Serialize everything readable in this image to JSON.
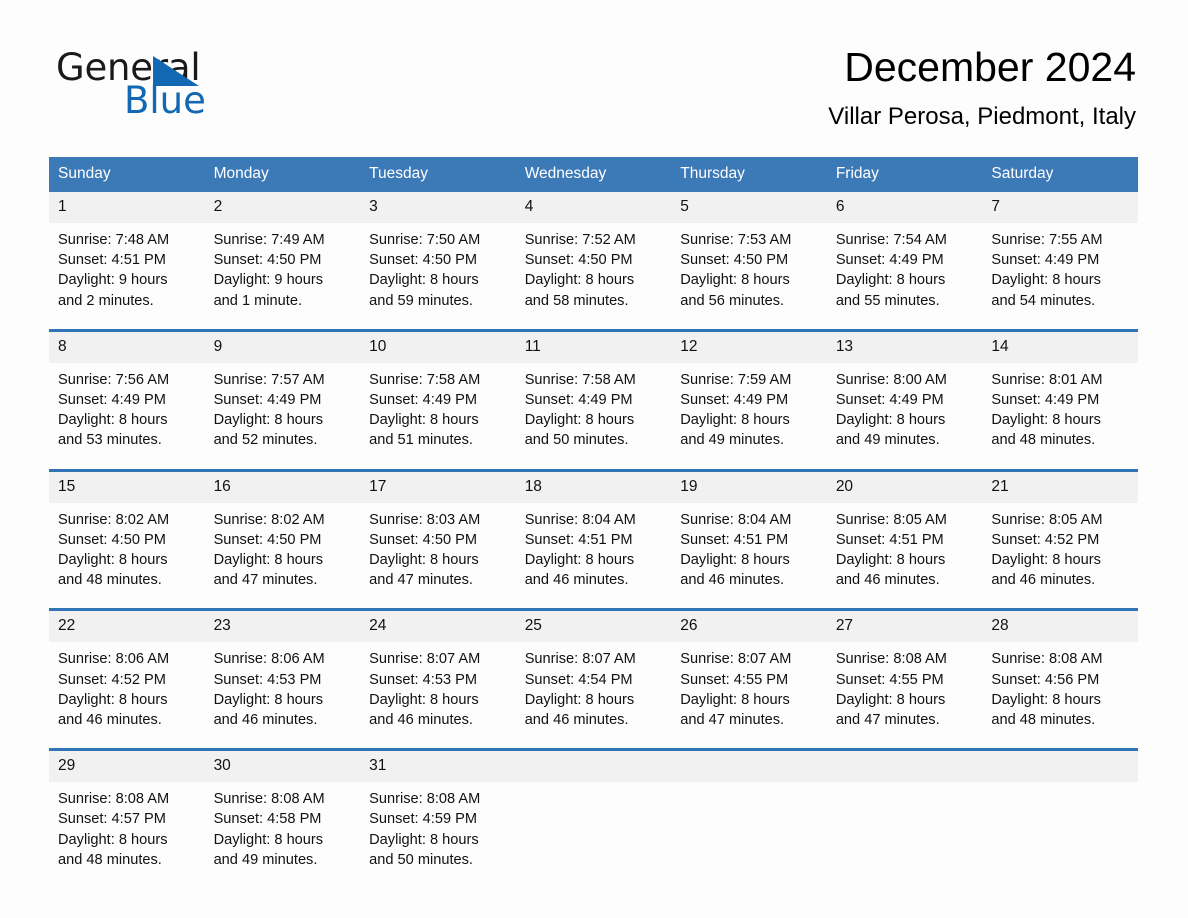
{
  "brand": {
    "name_part1": "General",
    "name_part2": "Blue",
    "accent_color": "#1268b3"
  },
  "header": {
    "title": "December 2024",
    "subtitle": "Villar Perosa, Piedmont, Italy"
  },
  "theme": {
    "header_blue": "#3b79b7",
    "separator_blue": "#2f74b5",
    "daynum_band": "#f1f1f1",
    "page_background": "#fdfdfd"
  },
  "columns": [
    "Sunday",
    "Monday",
    "Tuesday",
    "Wednesday",
    "Thursday",
    "Friday",
    "Saturday"
  ],
  "weeks": [
    {
      "days": [
        {
          "num": "1",
          "detail": "Sunrise: 7:48 AM\nSunset: 4:51 PM\nDaylight: 9 hours\nand 2 minutes."
        },
        {
          "num": "2",
          "detail": "Sunrise: 7:49 AM\nSunset: 4:50 PM\nDaylight: 9 hours\nand 1 minute."
        },
        {
          "num": "3",
          "detail": "Sunrise: 7:50 AM\nSunset: 4:50 PM\nDaylight: 8 hours\nand 59 minutes."
        },
        {
          "num": "4",
          "detail": "Sunrise: 7:52 AM\nSunset: 4:50 PM\nDaylight: 8 hours\nand 58 minutes."
        },
        {
          "num": "5",
          "detail": "Sunrise: 7:53 AM\nSunset: 4:50 PM\nDaylight: 8 hours\nand 56 minutes."
        },
        {
          "num": "6",
          "detail": "Sunrise: 7:54 AM\nSunset: 4:49 PM\nDaylight: 8 hours\nand 55 minutes."
        },
        {
          "num": "7",
          "detail": "Sunrise: 7:55 AM\nSunset: 4:49 PM\nDaylight: 8 hours\nand 54 minutes."
        }
      ]
    },
    {
      "days": [
        {
          "num": "8",
          "detail": "Sunrise: 7:56 AM\nSunset: 4:49 PM\nDaylight: 8 hours\nand 53 minutes."
        },
        {
          "num": "9",
          "detail": "Sunrise: 7:57 AM\nSunset: 4:49 PM\nDaylight: 8 hours\nand 52 minutes."
        },
        {
          "num": "10",
          "detail": "Sunrise: 7:58 AM\nSunset: 4:49 PM\nDaylight: 8 hours\nand 51 minutes."
        },
        {
          "num": "11",
          "detail": "Sunrise: 7:58 AM\nSunset: 4:49 PM\nDaylight: 8 hours\nand 50 minutes."
        },
        {
          "num": "12",
          "detail": "Sunrise: 7:59 AM\nSunset: 4:49 PM\nDaylight: 8 hours\nand 49 minutes."
        },
        {
          "num": "13",
          "detail": "Sunrise: 8:00 AM\nSunset: 4:49 PM\nDaylight: 8 hours\nand 49 minutes."
        },
        {
          "num": "14",
          "detail": "Sunrise: 8:01 AM\nSunset: 4:49 PM\nDaylight: 8 hours\nand 48 minutes."
        }
      ]
    },
    {
      "days": [
        {
          "num": "15",
          "detail": "Sunrise: 8:02 AM\nSunset: 4:50 PM\nDaylight: 8 hours\nand 48 minutes."
        },
        {
          "num": "16",
          "detail": "Sunrise: 8:02 AM\nSunset: 4:50 PM\nDaylight: 8 hours\nand 47 minutes."
        },
        {
          "num": "17",
          "detail": "Sunrise: 8:03 AM\nSunset: 4:50 PM\nDaylight: 8 hours\nand 47 minutes."
        },
        {
          "num": "18",
          "detail": "Sunrise: 8:04 AM\nSunset: 4:51 PM\nDaylight: 8 hours\nand 46 minutes."
        },
        {
          "num": "19",
          "detail": "Sunrise: 8:04 AM\nSunset: 4:51 PM\nDaylight: 8 hours\nand 46 minutes."
        },
        {
          "num": "20",
          "detail": "Sunrise: 8:05 AM\nSunset: 4:51 PM\nDaylight: 8 hours\nand 46 minutes."
        },
        {
          "num": "21",
          "detail": "Sunrise: 8:05 AM\nSunset: 4:52 PM\nDaylight: 8 hours\nand 46 minutes."
        }
      ]
    },
    {
      "days": [
        {
          "num": "22",
          "detail": "Sunrise: 8:06 AM\nSunset: 4:52 PM\nDaylight: 8 hours\nand 46 minutes."
        },
        {
          "num": "23",
          "detail": "Sunrise: 8:06 AM\nSunset: 4:53 PM\nDaylight: 8 hours\nand 46 minutes."
        },
        {
          "num": "24",
          "detail": "Sunrise: 8:07 AM\nSunset: 4:53 PM\nDaylight: 8 hours\nand 46 minutes."
        },
        {
          "num": "25",
          "detail": "Sunrise: 8:07 AM\nSunset: 4:54 PM\nDaylight: 8 hours\nand 46 minutes."
        },
        {
          "num": "26",
          "detail": "Sunrise: 8:07 AM\nSunset: 4:55 PM\nDaylight: 8 hours\nand 47 minutes."
        },
        {
          "num": "27",
          "detail": "Sunrise: 8:08 AM\nSunset: 4:55 PM\nDaylight: 8 hours\nand 47 minutes."
        },
        {
          "num": "28",
          "detail": "Sunrise: 8:08 AM\nSunset: 4:56 PM\nDaylight: 8 hours\nand 48 minutes."
        }
      ]
    },
    {
      "days": [
        {
          "num": "29",
          "detail": "Sunrise: 8:08 AM\nSunset: 4:57 PM\nDaylight: 8 hours\nand 48 minutes."
        },
        {
          "num": "30",
          "detail": "Sunrise: 8:08 AM\nSunset: 4:58 PM\nDaylight: 8 hours\nand 49 minutes."
        },
        {
          "num": "31",
          "detail": "Sunrise: 8:08 AM\nSunset: 4:59 PM\nDaylight: 8 hours\nand 50 minutes."
        },
        {
          "num": "",
          "detail": ""
        },
        {
          "num": "",
          "detail": ""
        },
        {
          "num": "",
          "detail": ""
        },
        {
          "num": "",
          "detail": ""
        }
      ]
    }
  ]
}
